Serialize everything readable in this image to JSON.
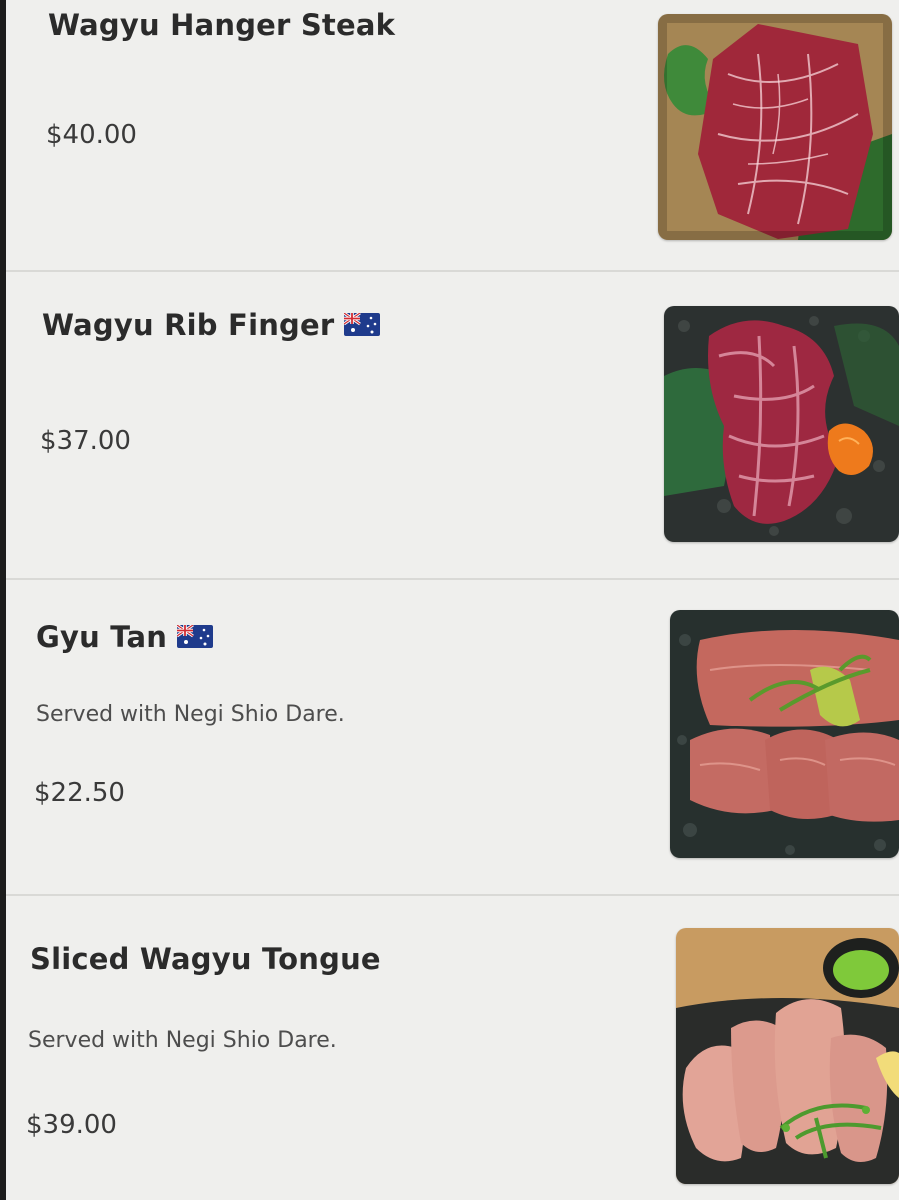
{
  "menu": {
    "items": [
      {
        "name": "Wagyu Hanger Steak",
        "flag_icon": "",
        "description": "",
        "price": "$40.00",
        "photo_icon": "wagyu-hanger-steak-photo"
      },
      {
        "name": "Wagyu Rib Finger",
        "flag_icon": "australia-flag-icon",
        "description": "",
        "price": "$37.00",
        "photo_icon": "wagyu-rib-finger-photo"
      },
      {
        "name": "Gyu Tan",
        "flag_icon": "australia-flag-icon",
        "description": "Served with Negi Shio Dare.",
        "price": "$22.50",
        "photo_icon": "gyu-tan-photo"
      },
      {
        "name": "Sliced Wagyu Tongue",
        "flag_icon": "",
        "description": "Served with Negi Shio Dare.",
        "price": "$39.00",
        "photo_icon": "sliced-wagyu-tongue-photo"
      }
    ]
  },
  "colors": {
    "background": "#eeeeec",
    "divider": "#d9d9d6",
    "text": "#2b2b2b"
  }
}
